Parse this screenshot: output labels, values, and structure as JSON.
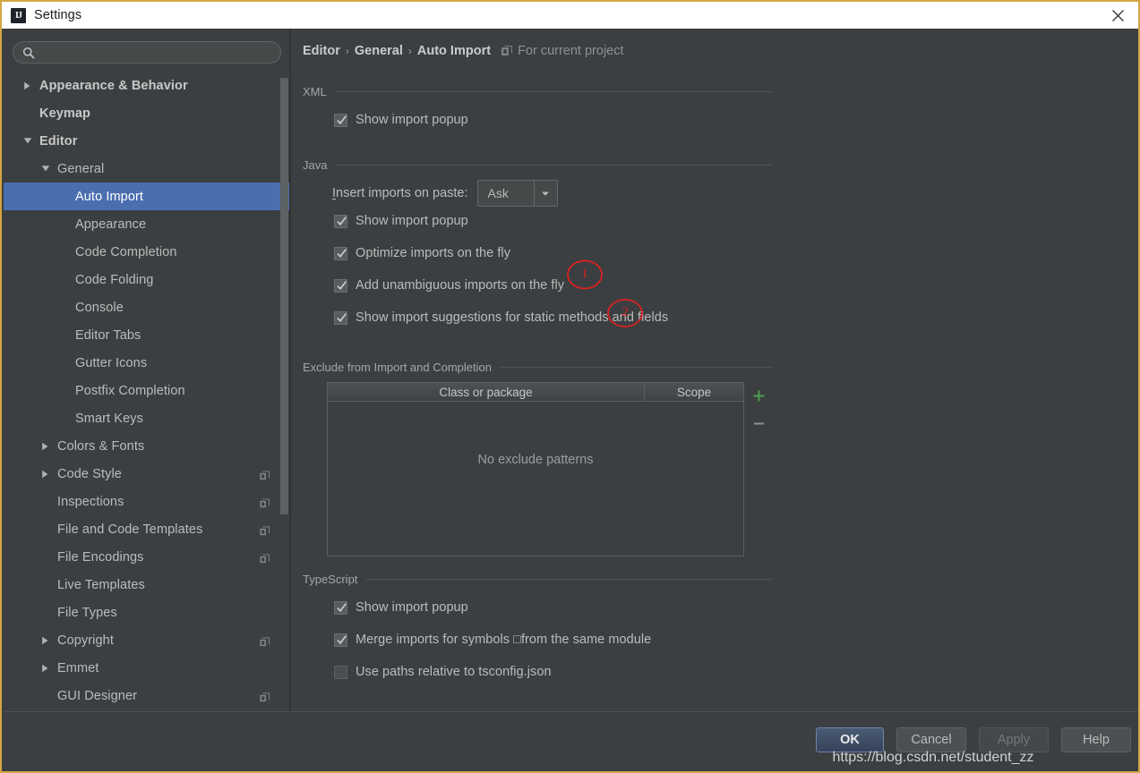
{
  "window": {
    "title": "Settings",
    "logo_text": "IJ",
    "close_icon": "close-icon",
    "border_color": "#d4a544",
    "background": "#3c3f41"
  },
  "sidebar": {
    "search": {
      "value": "",
      "placeholder": "",
      "icon": "search-icon"
    },
    "items": [
      {
        "label": "Appearance & Behavior",
        "indent": 0,
        "arrow": "collapsed",
        "bold": true,
        "selected": false,
        "project_icon": false
      },
      {
        "label": "Keymap",
        "indent": 0,
        "arrow": "none",
        "bold": true,
        "selected": false,
        "project_icon": false
      },
      {
        "label": "Editor",
        "indent": 0,
        "arrow": "expanded",
        "bold": true,
        "selected": false,
        "project_icon": false
      },
      {
        "label": "General",
        "indent": 1,
        "arrow": "expanded",
        "bold": false,
        "selected": false,
        "project_icon": false
      },
      {
        "label": "Auto Import",
        "indent": 2,
        "arrow": "none",
        "bold": false,
        "selected": true,
        "project_icon": false
      },
      {
        "label": "Appearance",
        "indent": 2,
        "arrow": "none",
        "bold": false,
        "selected": false,
        "project_icon": false
      },
      {
        "label": "Code Completion",
        "indent": 2,
        "arrow": "none",
        "bold": false,
        "selected": false,
        "project_icon": false
      },
      {
        "label": "Code Folding",
        "indent": 2,
        "arrow": "none",
        "bold": false,
        "selected": false,
        "project_icon": false
      },
      {
        "label": "Console",
        "indent": 2,
        "arrow": "none",
        "bold": false,
        "selected": false,
        "project_icon": false
      },
      {
        "label": "Editor Tabs",
        "indent": 2,
        "arrow": "none",
        "bold": false,
        "selected": false,
        "project_icon": false
      },
      {
        "label": "Gutter Icons",
        "indent": 2,
        "arrow": "none",
        "bold": false,
        "selected": false,
        "project_icon": false
      },
      {
        "label": "Postfix Completion",
        "indent": 2,
        "arrow": "none",
        "bold": false,
        "selected": false,
        "project_icon": false
      },
      {
        "label": "Smart Keys",
        "indent": 2,
        "arrow": "none",
        "bold": false,
        "selected": false,
        "project_icon": false
      },
      {
        "label": "Colors & Fonts",
        "indent": 1,
        "arrow": "collapsed",
        "bold": false,
        "selected": false,
        "project_icon": false
      },
      {
        "label": "Code Style",
        "indent": 1,
        "arrow": "collapsed",
        "bold": false,
        "selected": false,
        "project_icon": true
      },
      {
        "label": "Inspections",
        "indent": 1,
        "arrow": "none",
        "bold": false,
        "selected": false,
        "project_icon": true
      },
      {
        "label": "File and Code Templates",
        "indent": 1,
        "arrow": "none",
        "bold": false,
        "selected": false,
        "project_icon": true
      },
      {
        "label": "File Encodings",
        "indent": 1,
        "arrow": "none",
        "bold": false,
        "selected": false,
        "project_icon": true
      },
      {
        "label": "Live Templates",
        "indent": 1,
        "arrow": "none",
        "bold": false,
        "selected": false,
        "project_icon": false
      },
      {
        "label": "File Types",
        "indent": 1,
        "arrow": "none",
        "bold": false,
        "selected": false,
        "project_icon": false
      },
      {
        "label": "Copyright",
        "indent": 1,
        "arrow": "collapsed",
        "bold": false,
        "selected": false,
        "project_icon": true
      },
      {
        "label": "Emmet",
        "indent": 1,
        "arrow": "collapsed",
        "bold": false,
        "selected": false,
        "project_icon": false
      },
      {
        "label": "GUI Designer",
        "indent": 1,
        "arrow": "none",
        "bold": false,
        "selected": false,
        "project_icon": true
      }
    ],
    "selected_color": "#4b6eaf",
    "scrollbar": {
      "thumb_color": "#5c6163"
    }
  },
  "breadcrumb": {
    "parts": [
      "Editor",
      "General",
      "Auto Import"
    ],
    "separator": "›",
    "project_icon": "project-scope-icon",
    "note": "For current project"
  },
  "sections": {
    "xml": {
      "title": "XML",
      "options": [
        {
          "label": "Show import popup",
          "checked": true
        }
      ]
    },
    "java": {
      "title": "Java",
      "insert_imports": {
        "label_prefix": "",
        "label_mnemonic": "I",
        "label_rest": "nsert imports on paste:",
        "value": "Ask",
        "arrow_icon": "chevron-down-icon"
      },
      "options": [
        {
          "label": "Show import popup",
          "checked": true
        },
        {
          "label": "Optimize imports on the fly",
          "checked": true
        },
        {
          "label": "Add unambiguous imports on the fly",
          "checked": true
        },
        {
          "label": "Show import suggestions for static methods and fields",
          "checked": true
        }
      ]
    },
    "exclude": {
      "title": "Exclude from Import and Completion",
      "columns": [
        "Class or package",
        "Scope"
      ],
      "rows": [],
      "empty_text": "No exclude patterns",
      "add_button": {
        "icon": "plus-icon",
        "color": "#4f9e51"
      },
      "remove_button": {
        "icon": "minus-icon",
        "color": "#8c9093"
      }
    },
    "typescript": {
      "title": "TypeScript",
      "options": [
        {
          "label": "Show import popup",
          "checked": true
        },
        {
          "label": "Merge imports for symbols □from the same module",
          "checked": true
        },
        {
          "label": "Use paths relative to tsconfig.json",
          "checked": false
        }
      ]
    }
  },
  "annotations": [
    {
      "label": "1",
      "color": "#e02020"
    },
    {
      "label": "2",
      "color": "#e02020"
    }
  ],
  "footer": {
    "buttons": [
      {
        "label": "OK",
        "style": "default"
      },
      {
        "label": "Cancel",
        "style": "normal"
      },
      {
        "label": "Apply",
        "style": "disabled"
      },
      {
        "label": "Help",
        "style": "normal"
      }
    ]
  },
  "watermark": "https://blog.csdn.net/student_zz"
}
